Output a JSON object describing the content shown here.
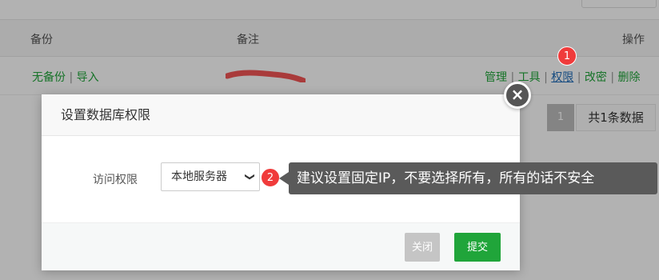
{
  "table": {
    "columns": [
      "备份",
      "备注",
      "操作"
    ],
    "row": {
      "backup_status": "无备份",
      "import_label": "导入",
      "actions": [
        "管理",
        "工具",
        "权限",
        "改密",
        "删除"
      ],
      "separator": "|"
    }
  },
  "pagination": {
    "current_page": "1",
    "total_text": "共1条数据"
  },
  "dialog": {
    "title": "设置数据库权限",
    "close_icon": "×",
    "field_label": "访问权限",
    "select_value": "本地服务器",
    "select_arrow": "❯",
    "close_button": "关闭",
    "submit_button": "提交"
  },
  "annotations": {
    "badge1": "1",
    "badge2": "2",
    "tooltip": "建议设置固定IP，不要选择所有，所有的话不安全"
  },
  "colors": {
    "accent_green": "#20a53a",
    "badge_red": "#f03b3b",
    "tooltip_bg": "#5a5a5a"
  }
}
